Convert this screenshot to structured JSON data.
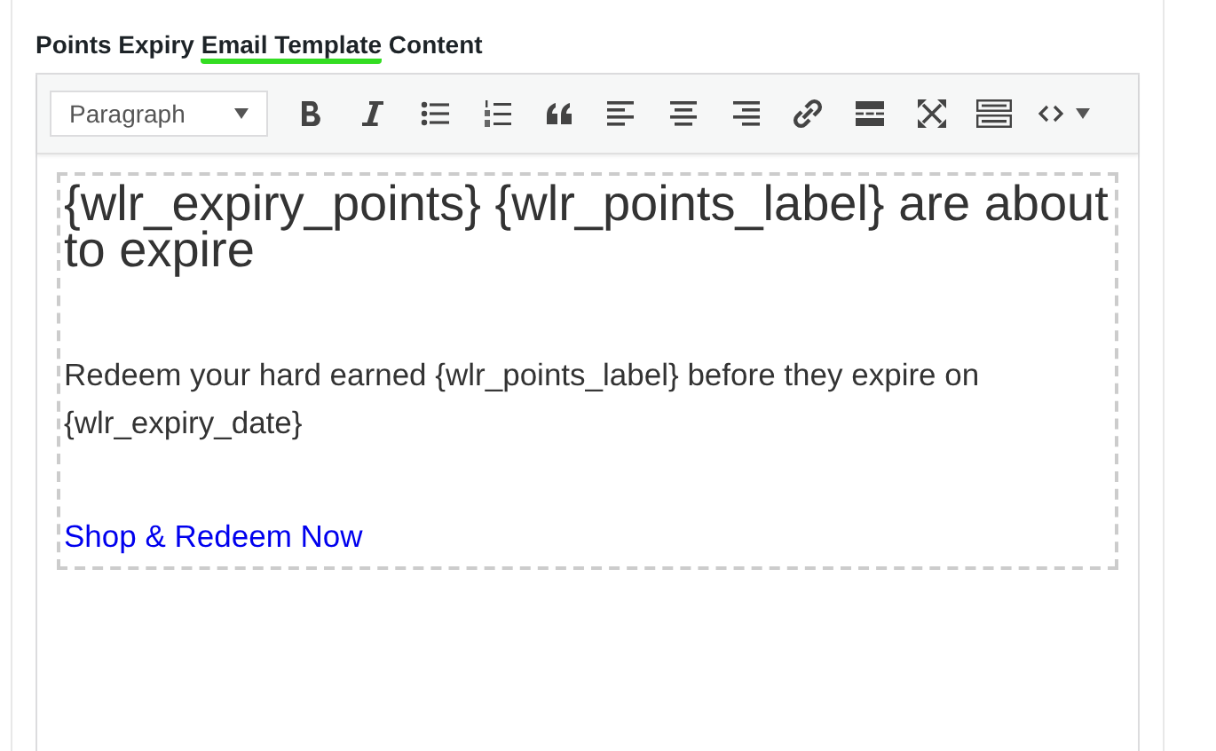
{
  "section_title": {
    "parts": [
      {
        "text": "Points Expiry ",
        "highlighted": false
      },
      {
        "text": "Email Template",
        "highlighted": true
      },
      {
        "text": " Content",
        "highlighted": false
      }
    ]
  },
  "toolbar": {
    "format_select": {
      "value": "Paragraph"
    },
    "buttons": [
      {
        "kind": "bold"
      },
      {
        "kind": "italic"
      },
      {
        "kind": "bullets"
      },
      {
        "kind": "numbers"
      },
      {
        "kind": "quote"
      },
      {
        "kind": "align-left"
      },
      {
        "kind": "align-center"
      },
      {
        "kind": "align-right"
      },
      {
        "kind": "link"
      },
      {
        "kind": "more"
      },
      {
        "kind": "fullscreen"
      },
      {
        "kind": "keyboard"
      },
      {
        "kind": "code"
      }
    ]
  },
  "content": {
    "heading": "{wlr_expiry_points} {wlr_points_label} are about to expire",
    "paragraph": "Redeem your hard earned {wlr_points_label} before they expire on {wlr_expiry_date}",
    "link": "Shop & Redeem Now"
  }
}
